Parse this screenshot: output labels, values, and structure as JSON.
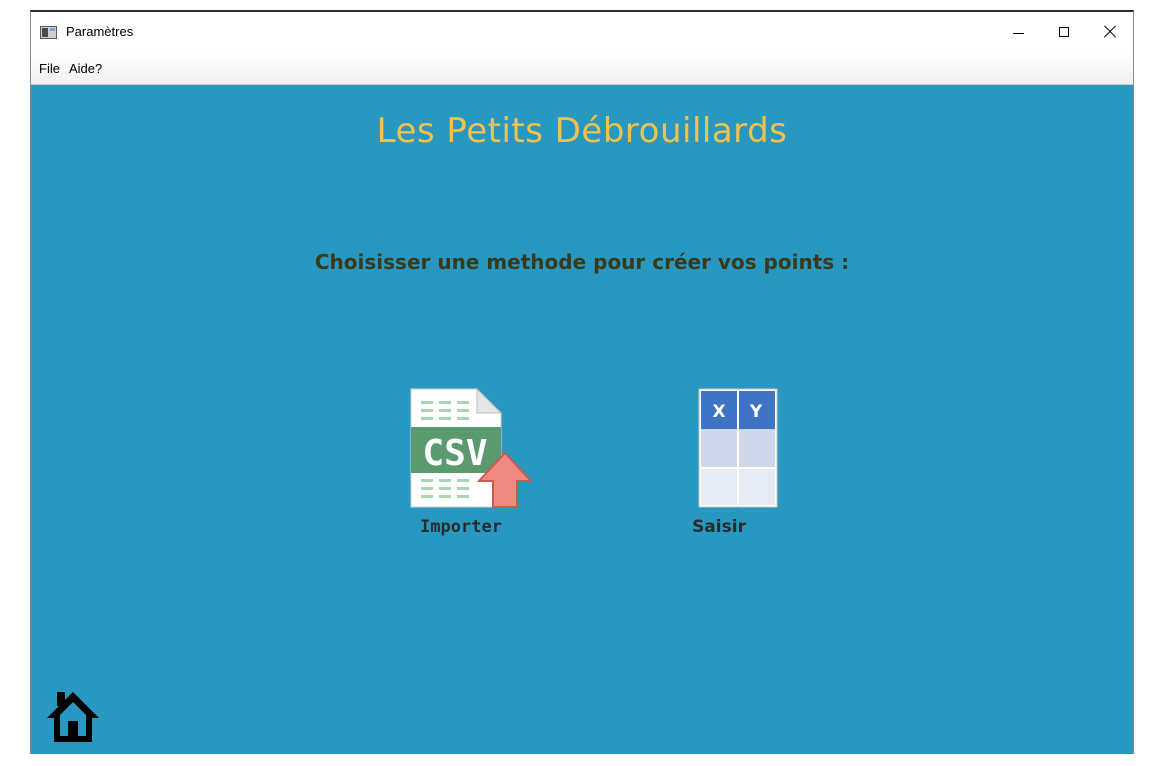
{
  "window": {
    "title": "Paramètres"
  },
  "menu": {
    "items": [
      "File",
      "Aide?"
    ]
  },
  "main": {
    "title": "Les Petits Débrouillards",
    "subtitle": "Choisisser une methode pour créer vos points :",
    "options": [
      {
        "label": "Importer",
        "icon": "csv-import-icon",
        "badge_text": "CSV"
      },
      {
        "label": "Saisir",
        "icon": "xy-table-icon",
        "col_x": "X",
        "col_y": "Y"
      }
    ]
  },
  "footer": {
    "home_icon": "home-icon"
  },
  "colors": {
    "background": "#2898c0",
    "title": "#f2c14e",
    "subtitle": "#3a3a1a",
    "csv_band": "#5a9a6e",
    "arrow": "#f08a80",
    "table_header": "#3f73c4"
  }
}
